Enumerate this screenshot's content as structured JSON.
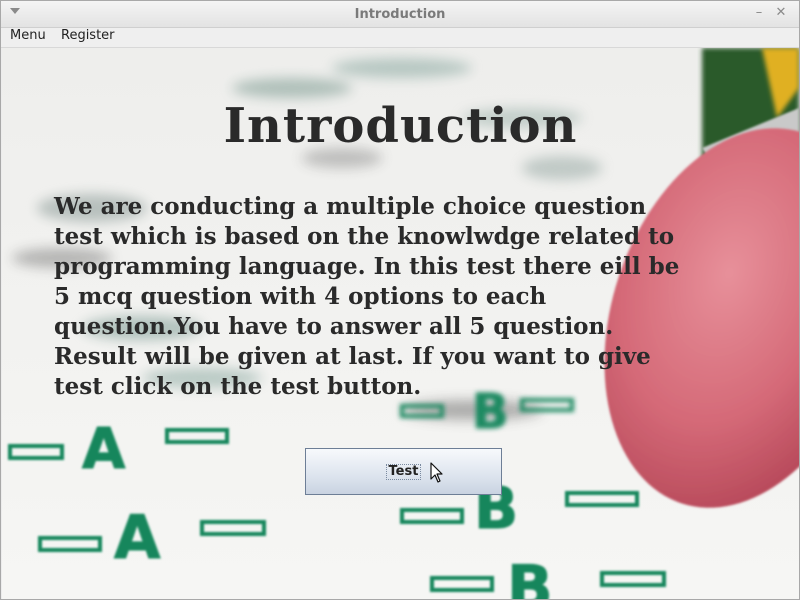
{
  "window": {
    "title": "Introduction"
  },
  "menubar": {
    "items": [
      {
        "label": "Menu"
      },
      {
        "label": "Register"
      }
    ]
  },
  "main": {
    "heading": "Introduction",
    "body": "We are conducting a multiple choice question\ntest which is based on the knowlwdge related to\nprogramming language. In this test there eill be\n5 mcq question with 4 options to each\nquestion.You have to answer all 5 question.\nResult will be given at last. If you want to give\ntest click on the test button.",
    "test_button_label": "Test"
  },
  "icons": {
    "window_menu": "chevron-down-icon",
    "minimize": "minimize-icon",
    "close": "close-icon",
    "cursor": "mouse-pointer-icon"
  },
  "colors": {
    "heading_text": "#2a2a2a",
    "answer_sheet_green": "#1a8a62",
    "eraser_pink": "#d86a78",
    "button_border": "#6d7e96"
  }
}
